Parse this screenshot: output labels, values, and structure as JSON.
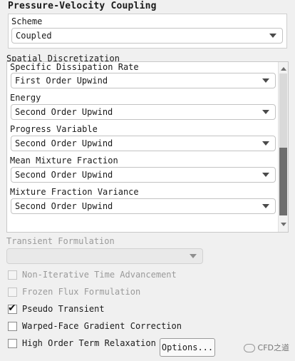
{
  "pvc": {
    "title": "Pressure-Velocity Coupling",
    "scheme_label": "Scheme",
    "scheme_value": "Coupled"
  },
  "spatial": {
    "title": "Spatial Discretization",
    "fields": [
      {
        "label": "Specific Dissipation Rate",
        "value": "First Order Upwind"
      },
      {
        "label": "Energy",
        "value": "Second Order Upwind"
      },
      {
        "label": "Progress Variable",
        "value": "Second Order Upwind"
      },
      {
        "label": "Mean Mixture Fraction",
        "value": "Second Order Upwind"
      },
      {
        "label": "Mixture Fraction Variance",
        "value": "Second Order Upwind"
      }
    ]
  },
  "transient": {
    "label": "Transient Formulation",
    "value": ""
  },
  "options": [
    {
      "label": "Non-Iterative Time Advancement",
      "checked": false,
      "enabled": false
    },
    {
      "label": "Frozen Flux Formulation",
      "checked": false,
      "enabled": false
    },
    {
      "label": "Pseudo Transient",
      "checked": true,
      "enabled": true
    },
    {
      "label": "Warped-Face Gradient Correction",
      "checked": false,
      "enabled": true
    },
    {
      "label": "High Order Term Relaxation",
      "checked": false,
      "enabled": true
    }
  ],
  "options_button": "Options...",
  "watermark": "CFD之道"
}
